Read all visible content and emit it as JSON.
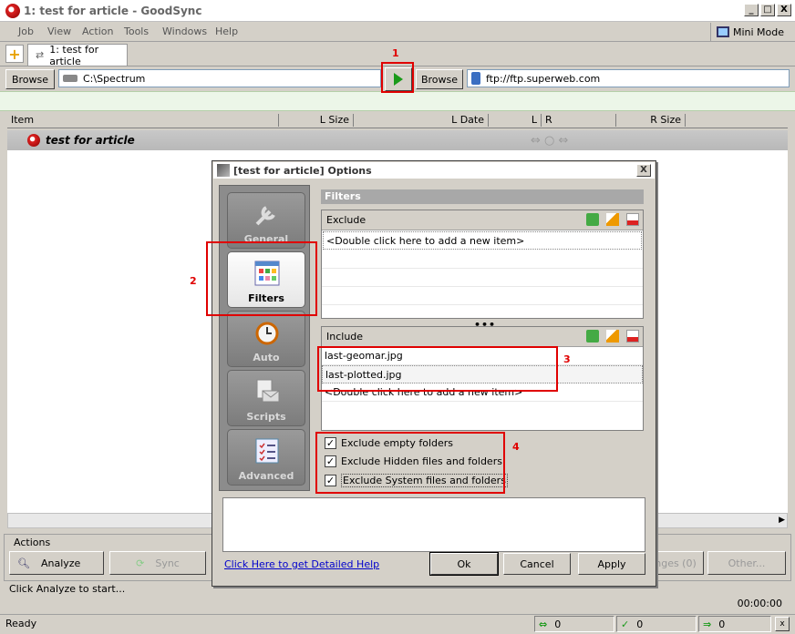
{
  "window": {
    "title": "1: test for article - GoodSync",
    "min": "_",
    "max": "□",
    "close": "X"
  },
  "menu": [
    "Job",
    "View",
    "Action",
    "Tools",
    "Windows",
    "Help"
  ],
  "mini_mode": "Mini Mode",
  "job_tab": "1: test for article",
  "left": {
    "browse": "Browse",
    "path": "C:\\Spectrum"
  },
  "right": {
    "browse": "Browse",
    "path": "ftp://ftp.superweb.com"
  },
  "columns": [
    "Item",
    "L Size",
    "L Date",
    "L",
    "R",
    "R Size"
  ],
  "job_row": "test for article",
  "actions": {
    "label": "Actions",
    "analyze": "Analyze",
    "sync": "Sync",
    "changes": "nges (0)",
    "other": "Other..."
  },
  "status_message": "Click Analyze to start...",
  "timer": "00:00:00",
  "statusbar": {
    "ready": "Ready",
    "c1": "0",
    "c2": "0",
    "c3": "0"
  },
  "dialog": {
    "title": "[test for article] Options",
    "close": "X",
    "nav": [
      "General",
      "Filters",
      "Auto",
      "Scripts",
      "Advanced"
    ],
    "section": "Filters",
    "exclude": {
      "label": "Exclude",
      "items": [
        "<Double click here to add a new item>"
      ]
    },
    "include": {
      "label": "Include",
      "items": [
        "last-geomar.jpg",
        "last-plotted.jpg",
        "<Double click here to add a new item>"
      ]
    },
    "checks": [
      {
        "label": "Exclude empty folders",
        "checked": true
      },
      {
        "label": "Exclude Hidden files and folders",
        "checked": true
      },
      {
        "label": "Exclude System files and folders",
        "checked": true
      }
    ],
    "help_link": "Click Here to get Detailed Help",
    "ok": "Ok",
    "cancel": "Cancel",
    "apply": "Apply"
  },
  "annotations": [
    "1",
    "2",
    "3",
    "4"
  ]
}
